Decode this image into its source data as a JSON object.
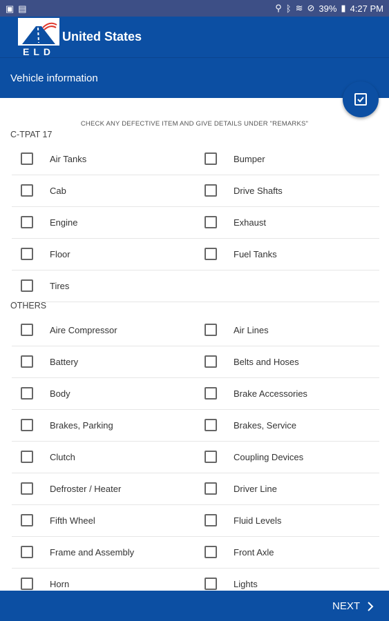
{
  "statusbar": {
    "battery": "39%",
    "time": "4:27 PM"
  },
  "app": {
    "title": "United States",
    "subtitle": "Vehicle information",
    "logo_text": "ELD"
  },
  "instructions": "CHECK ANY DEFECTIVE ITEM AND GIVE DETAILS UNDER \"REMARKS\"",
  "sections": [
    {
      "title": "C-TPAT 17",
      "items": [
        "Air Tanks",
        "Bumper",
        "Cab",
        "Drive Shafts",
        "Engine",
        "Exhaust",
        "Floor",
        "Fuel Tanks",
        "Tires"
      ]
    },
    {
      "title": "OTHERS",
      "items": [
        "Aire Compressor",
        "Air Lines",
        "Battery",
        "Belts and Hoses",
        "Body",
        "Brake Accessories",
        "Brakes, Parking",
        "Brakes, Service",
        "Clutch",
        "Coupling Devices",
        "Defroster / Heater",
        "Driver Line",
        "Fifth Wheel",
        "Fluid Levels",
        "Frame and Assembly",
        "Front Axle",
        "Horn",
        "Lights"
      ]
    }
  ],
  "footer": {
    "next_label": "NEXT"
  }
}
